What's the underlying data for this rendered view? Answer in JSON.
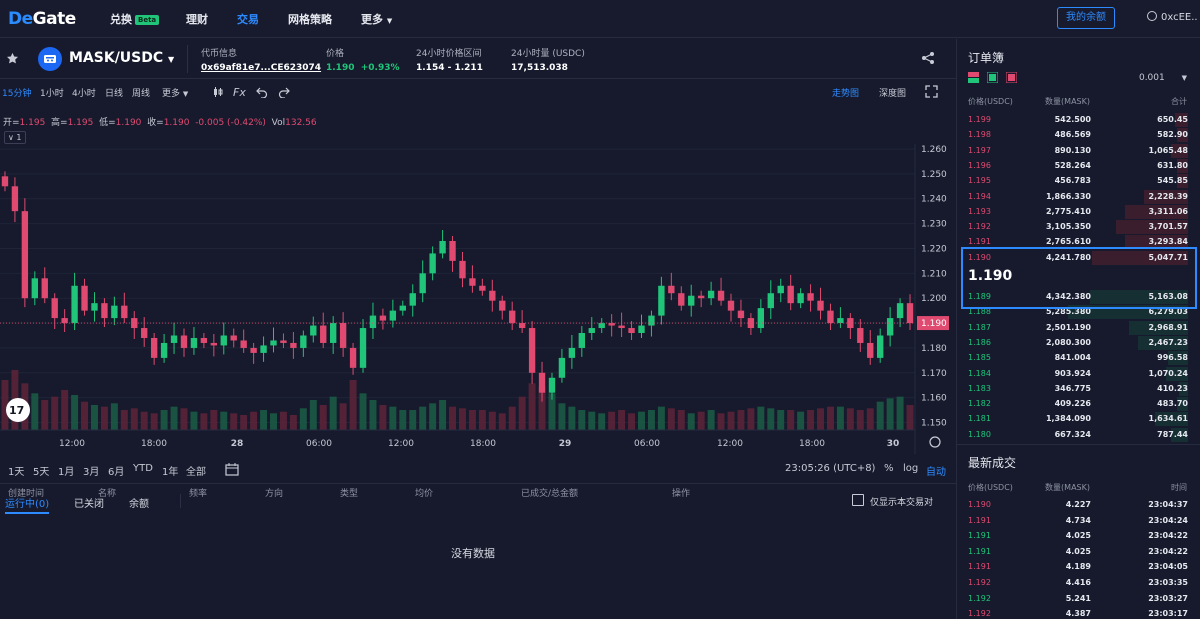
{
  "nav": {
    "logo_a": "De",
    "logo_b": "Gate",
    "items": [
      {
        "label": "兑换",
        "badge": "Beta"
      },
      {
        "label": "理财"
      },
      {
        "label": "交易"
      },
      {
        "label": "网格策略"
      },
      {
        "label": "更多"
      }
    ],
    "balance_button": "我的余额",
    "account": "0xcEE.."
  },
  "ticker": {
    "pair": "MASK/USDC",
    "contract_label": "代币信息",
    "contract": "0x69af81e7...CE623074",
    "price_label": "价格",
    "price": "1.190",
    "change": "+0.93%",
    "range_label": "24小时价格区间",
    "range": "1.154 - 1.211",
    "volume_label": "24小时量 (USDC)",
    "volume": "17,513.038"
  },
  "chart_toolbar": {
    "timeframes": [
      "15分钟",
      "1小时",
      "4小时",
      "日线",
      "周线",
      "更多"
    ],
    "fx": "Fx",
    "trend_tab": "走势图",
    "depth_tab": "深度图"
  },
  "ohlc": {
    "o_label": "开=",
    "o": "1.195",
    "h_label": "高=",
    "h": "1.195",
    "l_label": "低=",
    "l": "1.190",
    "c_label": "收=",
    "c": "1.190",
    "chg": "-0.005 (-0.42%)",
    "vol_label": "Vol",
    "vol": "132.56"
  },
  "legend_count": "1",
  "chart_data": {
    "type": "candlestick",
    "y_ticks": [
      "1.260",
      "1.250",
      "1.240",
      "1.230",
      "1.220",
      "1.210",
      "1.200",
      "1.190",
      "1.180",
      "1.170",
      "1.160",
      "1.150"
    ],
    "ylim": [
      1.147,
      1.262
    ],
    "x_ticks": [
      "12:00",
      "18:00",
      "28",
      "06:00",
      "12:00",
      "18:00",
      "29",
      "06:00",
      "12:00",
      "18:00",
      "30"
    ],
    "last_price": "1.190",
    "close": [
      1.245,
      1.235,
      1.2,
      1.208,
      1.2,
      1.192,
      1.19,
      1.205,
      1.195,
      1.198,
      1.192,
      1.197,
      1.192,
      1.188,
      1.184,
      1.176,
      1.182,
      1.185,
      1.18,
      1.184,
      1.182,
      1.181,
      1.185,
      1.183,
      1.18,
      1.178,
      1.181,
      1.183,
      1.182,
      1.18,
      1.185,
      1.189,
      1.182,
      1.19,
      1.18,
      1.172,
      1.188,
      1.193,
      1.191,
      1.195,
      1.197,
      1.202,
      1.21,
      1.218,
      1.223,
      1.215,
      1.208,
      1.205,
      1.203,
      1.199,
      1.195,
      1.19,
      1.188,
      1.17,
      1.162,
      1.168,
      1.176,
      1.18,
      1.186,
      1.188,
      1.19,
      1.189,
      1.188,
      1.186,
      1.189,
      1.193,
      1.205,
      1.202,
      1.197,
      1.201,
      1.2,
      1.203,
      1.199,
      1.195,
      1.192,
      1.188,
      1.196,
      1.202,
      1.205,
      1.198,
      1.202,
      1.199,
      1.195,
      1.19,
      1.192,
      1.188,
      1.182,
      1.176,
      1.185,
      1.192,
      1.198,
      1.19
    ],
    "volume": [
      30,
      36,
      28,
      22,
      18,
      20,
      24,
      21,
      17,
      15,
      14,
      16,
      12,
      13,
      11,
      10,
      12,
      14,
      13,
      11,
      10,
      12,
      11,
      10,
      9,
      11,
      12,
      10,
      11,
      9,
      13,
      18,
      15,
      20,
      16,
      30,
      22,
      18,
      15,
      14,
      12,
      12,
      14,
      16,
      18,
      14,
      13,
      12,
      12,
      11,
      10,
      14,
      20,
      28,
      26,
      22,
      16,
      14,
      12,
      11,
      10,
      11,
      12,
      10,
      11,
      12,
      14,
      13,
      12,
      10,
      11,
      12,
      10,
      11,
      12,
      13,
      14,
      13,
      12,
      12,
      11,
      12,
      13,
      14,
      14,
      13,
      12,
      13,
      17,
      19,
      20,
      15
    ]
  },
  "range_bar": {
    "items": [
      "1天",
      "5天",
      "1月",
      "3月",
      "6月",
      "YTD",
      "1年",
      "全部"
    ],
    "clock": "23:05:26 (UTC+8)",
    "pct": "%",
    "log": "log",
    "auto": "自动"
  },
  "orders": {
    "tabs": [
      "运行中(0)",
      "已关闭",
      "余额"
    ],
    "only_pair": "仅显示本交易对",
    "columns": [
      "创建时间",
      "名称",
      "频率",
      "方向",
      "类型",
      "均价",
      "已成交/总金额",
      "操作"
    ],
    "empty": "没有数据"
  },
  "orderbook": {
    "title": "订单簿",
    "precision": "0.001",
    "headers": [
      "价格(USDC)",
      "数量(MASK)",
      "合计"
    ],
    "asks": [
      {
        "price": "1.199",
        "qty": "542.500",
        "total": "650.45",
        "depth": 0.06
      },
      {
        "price": "1.198",
        "qty": "486.569",
        "total": "582.90",
        "depth": 0.05
      },
      {
        "price": "1.197",
        "qty": "890.130",
        "total": "1,065.48",
        "depth": 0.08
      },
      {
        "price": "1.196",
        "qty": "528.264",
        "total": "631.80",
        "depth": 0.05
      },
      {
        "price": "1.195",
        "qty": "456.783",
        "total": "545.85",
        "depth": 0.05
      },
      {
        "price": "1.194",
        "qty": "1,866.330",
        "total": "2,228.39",
        "depth": 0.2
      },
      {
        "price": "1.193",
        "qty": "2,775.410",
        "total": "3,311.06",
        "depth": 0.29
      },
      {
        "price": "1.192",
        "qty": "3,105.350",
        "total": "3,701.57",
        "depth": 0.33
      },
      {
        "price": "1.191",
        "qty": "2,765.610",
        "total": "3,293.84",
        "depth": 0.29
      },
      {
        "price": "1.190",
        "qty": "4,241.780",
        "total": "5,047.71",
        "depth": 0.44
      }
    ],
    "last": "1.190",
    "bids": [
      {
        "price": "1.189",
        "qty": "4,342.380",
        "total": "5,163.08",
        "depth": 0.45
      },
      {
        "price": "1.188",
        "qty": "5,285.380",
        "total": "6,279.03",
        "depth": 0.55
      },
      {
        "price": "1.187",
        "qty": "2,501.190",
        "total": "2,968.91",
        "depth": 0.27
      },
      {
        "price": "1.186",
        "qty": "2,080.300",
        "total": "2,467.23",
        "depth": 0.23
      },
      {
        "price": "1.185",
        "qty": "841.004",
        "total": "996.58",
        "depth": 0.09
      },
      {
        "price": "1.184",
        "qty": "903.924",
        "total": "1,070.24",
        "depth": 0.1
      },
      {
        "price": "1.183",
        "qty": "346.775",
        "total": "410.23",
        "depth": 0.04
      },
      {
        "price": "1.182",
        "qty": "409.226",
        "total": "483.70",
        "depth": 0.05
      },
      {
        "price": "1.181",
        "qty": "1,384.090",
        "total": "1,634.61",
        "depth": 0.15
      },
      {
        "price": "1.180",
        "qty": "667.324",
        "total": "787.44",
        "depth": 0.08
      }
    ]
  },
  "trades": {
    "title": "最新成交",
    "headers": [
      "价格(USDC)",
      "数量(MASK)",
      "时间"
    ],
    "rows": [
      {
        "price": "1.190",
        "qty": "4.227",
        "time": "23:04:37",
        "side": "sell"
      },
      {
        "price": "1.191",
        "qty": "4.734",
        "time": "23:04:24",
        "side": "sell"
      },
      {
        "price": "1.191",
        "qty": "4.025",
        "time": "23:04:22",
        "side": "buy"
      },
      {
        "price": "1.191",
        "qty": "4.025",
        "time": "23:04:22",
        "side": "buy"
      },
      {
        "price": "1.191",
        "qty": "4.189",
        "time": "23:04:05",
        "side": "sell"
      },
      {
        "price": "1.192",
        "qty": "4.416",
        "time": "23:03:35",
        "side": "sell"
      },
      {
        "price": "1.192",
        "qty": "5.241",
        "time": "23:03:27",
        "side": "buy"
      },
      {
        "price": "1.192",
        "qty": "4.387",
        "time": "23:03:17",
        "side": "sell"
      }
    ]
  },
  "colors": {
    "up": "#20c57a",
    "down": "#e04a70",
    "accent": "#2e8bff",
    "bg": "#161a2c"
  }
}
